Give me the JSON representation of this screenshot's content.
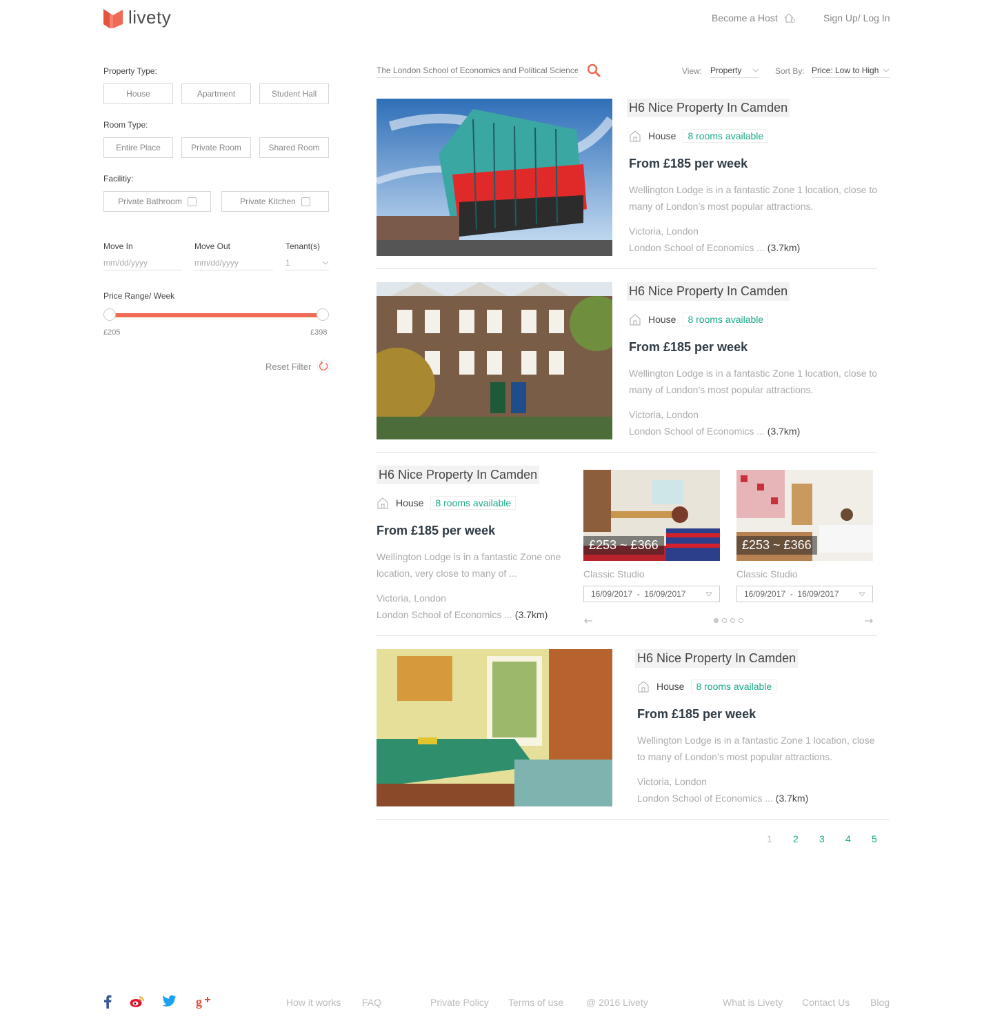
{
  "brand": {
    "name": "livety",
    "color": "#f06b55"
  },
  "header": {
    "become_host": "Become a Host",
    "signup_login": "Sign Up/ Log In"
  },
  "filters": {
    "property_type_label": "Property Type:",
    "property_types": [
      "House",
      "Apartment",
      "Student Hall"
    ],
    "room_type_label": "Room Type:",
    "room_types": [
      "Entire Place",
      "Private Room",
      "Shared Room"
    ],
    "facility_label": "Facilitiy:",
    "facilities": [
      "Private Bathroom",
      "Private Kitchen"
    ],
    "move_in_label": "Move In",
    "move_in_placeholder": "mm/dd/yyyy",
    "move_out_label": "Move Out",
    "move_out_placeholder": "mm/dd/yyyy",
    "tenants_label": "Tenant(s)",
    "tenants_value": "1",
    "price_range_label": "Price Range/ Week",
    "price_min": "£205",
    "price_max": "£398",
    "reset_label": "Reset Filter"
  },
  "toolbar": {
    "search_value": "The London School of Economics and Political Science",
    "view_label": "View:",
    "view_value": "Property",
    "sort_label": "Sort By:",
    "sort_value": "Price: Low to High"
  },
  "listings": [
    {
      "title": "H6 Nice Property In Camden",
      "type": "House",
      "rooms": "8 rooms available",
      "price": "From £185 per week",
      "desc1": "Wellington Lodge is in a fantastic Zone 1 location, close to",
      "desc2": "many of London’s most popular attractions.",
      "location": "Victoria, London",
      "school": "London School of Economics ...",
      "distance": "(3.7km)"
    },
    {
      "title": "H6 Nice Property In Camden",
      "type": "House",
      "rooms": "8 rooms available",
      "price": "From £185 per week",
      "desc1": "Wellington Lodge is in a fantastic Zone 1 location, close to",
      "desc2": "many of London’s most popular attractions.",
      "location": "Victoria, London",
      "school": "London School of Economics ...",
      "distance": "(3.7km)"
    },
    {
      "title": "H6 Nice Property In Camden",
      "type": "House",
      "rooms": "8 rooms available",
      "price": "From £185 per week",
      "desc1": "Wellington Lodge is in a fantastic Zone one",
      "desc2": "location, very close to many of ...",
      "location": "Victoria, London",
      "school": "London School of Economics ...",
      "distance": "(3.7km)",
      "rooms_list": [
        {
          "price": "£253 ~ £366",
          "name": "Classic Studio",
          "date_from": "16/09/2017",
          "date_to": "16/09/2017"
        },
        {
          "price": "£253 ~ £366",
          "name": "Classic Studio",
          "date_from": "16/09/2017",
          "date_to": "16/09/2017"
        }
      ]
    },
    {
      "title": "H6 Nice Property In Camden",
      "type": "House",
      "rooms": "8 rooms available",
      "price": "From £185 per week",
      "desc1": "Wellington Lodge is in a fantastic Zone 1 location, close",
      "desc2": "to many of London’s most popular attractions.",
      "location": "Victoria, London",
      "school": "London School of Economics ...",
      "distance": "(3.7km)"
    }
  ],
  "pagination": {
    "pages": [
      "1",
      "2",
      "3",
      "4",
      "5"
    ],
    "current": "1"
  },
  "footer": {
    "links": [
      "How it works",
      "FAQ",
      "Private Policy",
      "Terms of use",
      "@ 2016 Livety",
      "What is Livety",
      "Contact Us",
      "Blog"
    ],
    "social": [
      "facebook-icon",
      "weibo-icon",
      "twitter-icon",
      "google-plus-icon"
    ]
  }
}
